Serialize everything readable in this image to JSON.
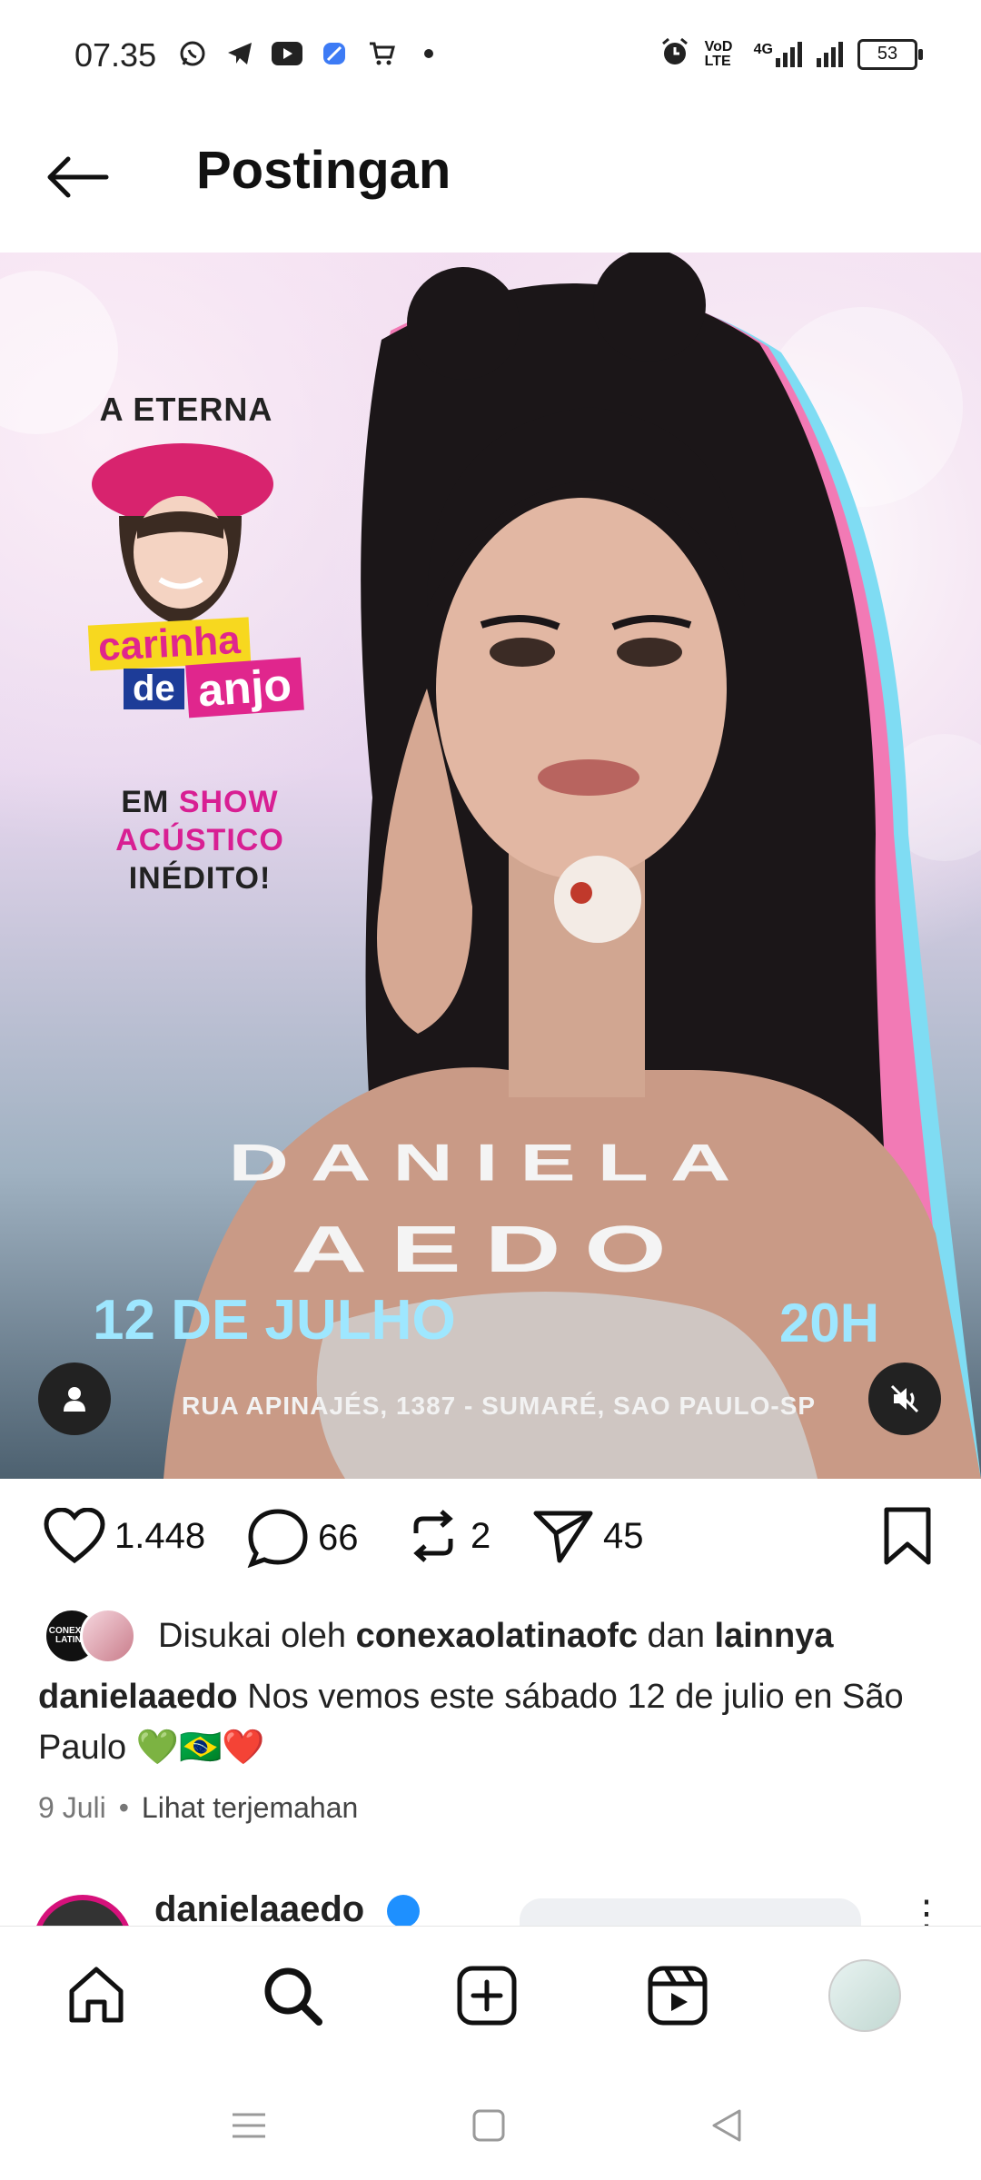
{
  "status_bar": {
    "time": "07.35",
    "icons": [
      "whatsapp-icon",
      "telegram-icon",
      "youtube-icon",
      "app-icon",
      "cart-icon",
      "dot-icon"
    ],
    "right_icons": [
      "alarm-icon",
      "volte-icon",
      "4g-signal-icon",
      "signal-icon"
    ],
    "volte_text": "VoD LTE",
    "net_text": "4G",
    "battery": "53"
  },
  "header": {
    "title": "Postingan"
  },
  "post": {
    "media": {
      "a_eterna": "A ETERNA",
      "logo_line1": "carinha",
      "logo_de": "de",
      "logo_anjo": "anjo",
      "show_line1_prefix": "EM",
      "show_line1_pink": "SHOW",
      "show_line2": "ACÚSTICO",
      "show_line3": "INÉDITO!",
      "name_line1": "DANIELA",
      "name_line2": "AEDO",
      "date": "12 DE JULHO",
      "hour": "20H",
      "address": "RUA APINAJÉS, 1387 - SUMARÉ, SAO PAULO-SP"
    },
    "actions": {
      "likes": "1.448",
      "comments": "66",
      "reposts": "2",
      "shares": "45"
    },
    "liked_by": {
      "prefix": "Disukai oleh",
      "user": "conexaolatinaofc",
      "middle": "dan",
      "others": "lainnya",
      "avatar_text": "CONEXÃO LATINA"
    },
    "caption": {
      "username": "danielaaedo",
      "text": "Nos vemos este sábado 12 de julio en São Paulo 💚🇧🇷❤️"
    },
    "date": "9 Juli",
    "separator": "•",
    "translate": "Lihat terjemahan"
  },
  "next_post": {
    "username": "danielaaedo",
    "more": "⋮"
  },
  "nav": [
    "home-icon",
    "search-icon",
    "create-icon",
    "reels-icon",
    "profile-avatar"
  ],
  "system_nav": [
    "menu-icon",
    "home-square-icon",
    "back-triangle-icon"
  ]
}
